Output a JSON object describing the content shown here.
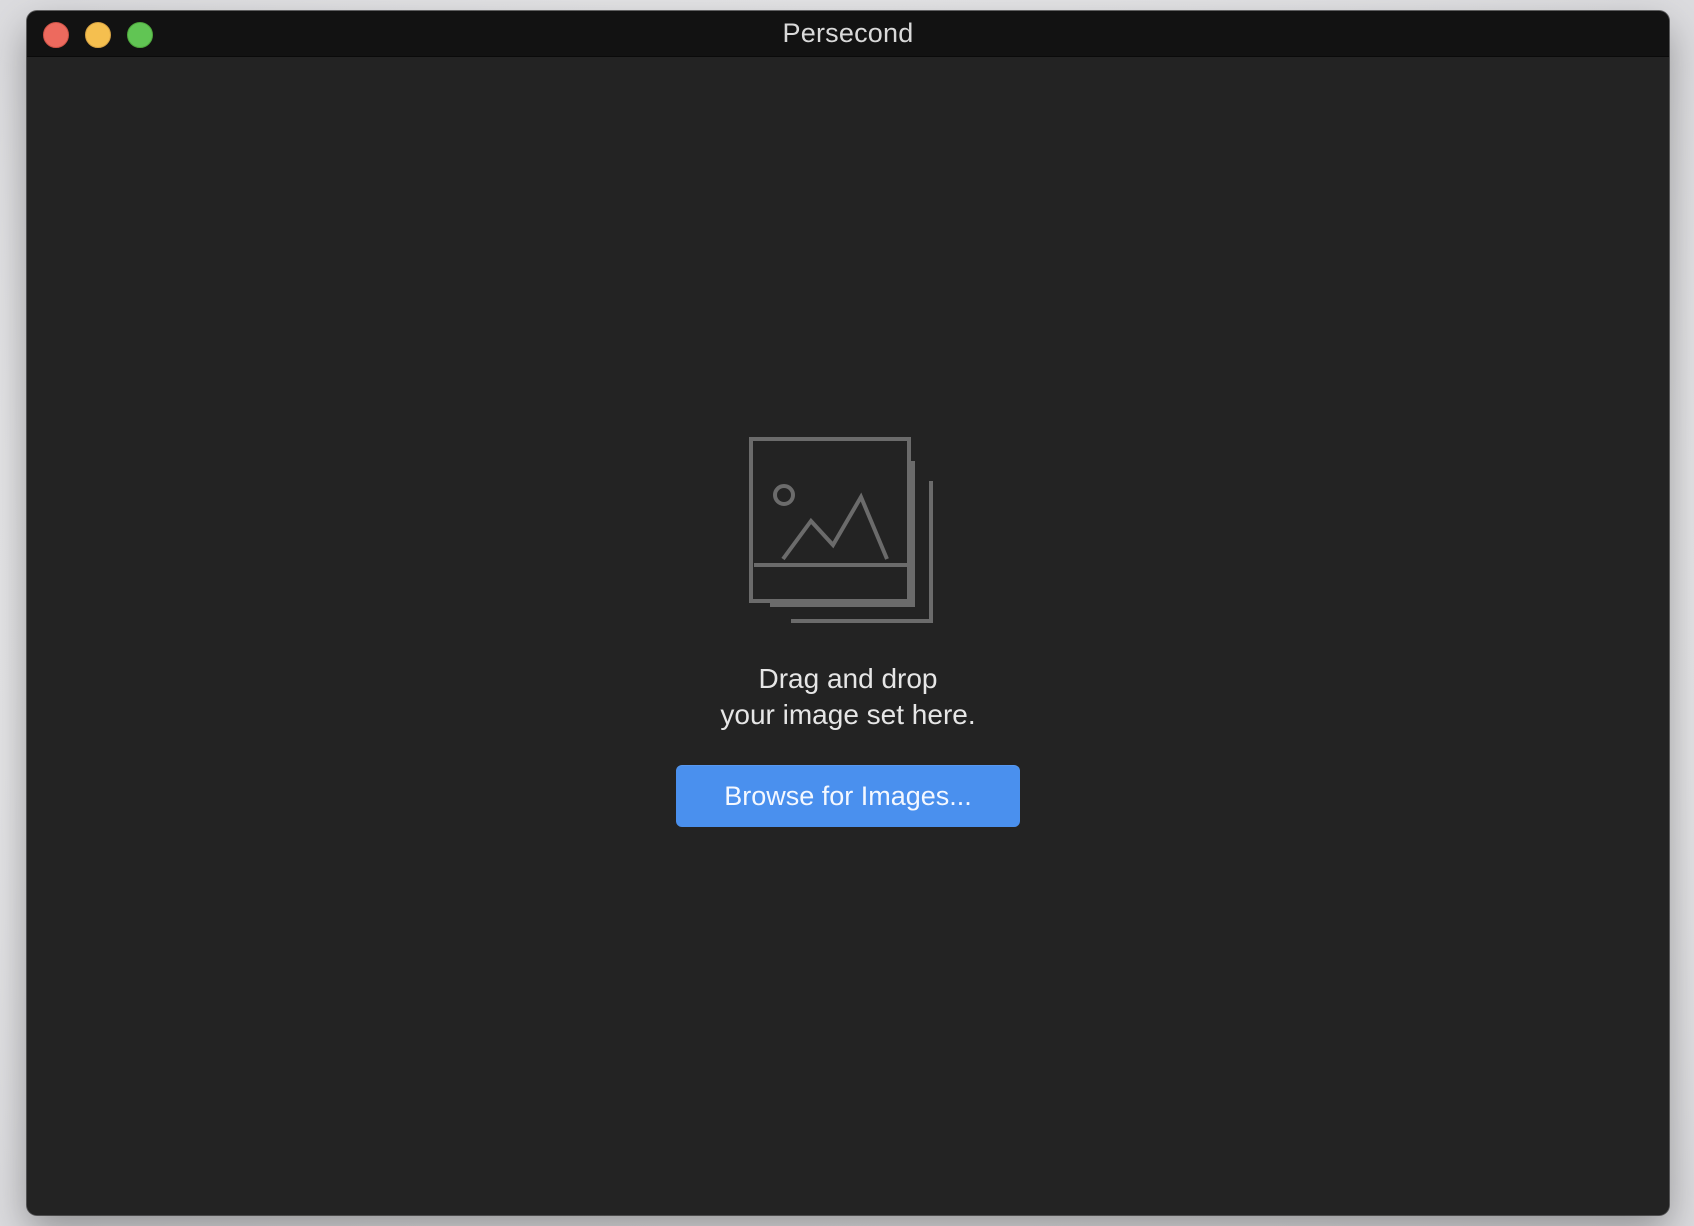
{
  "window": {
    "title": "Persecond"
  },
  "drop_zone": {
    "icon": "image-stack-icon",
    "line1": "Drag and drop",
    "line2": "your image set here."
  },
  "browse_button": {
    "label": "Browse for Images..."
  },
  "colors": {
    "window_background": "#232323",
    "titlebar_background": "#121212",
    "accent": "#4a90ee",
    "close": "#ed6a5e",
    "minimize": "#f5bf4f",
    "zoom": "#61c554",
    "icon_stroke": "#6b6b6b"
  }
}
